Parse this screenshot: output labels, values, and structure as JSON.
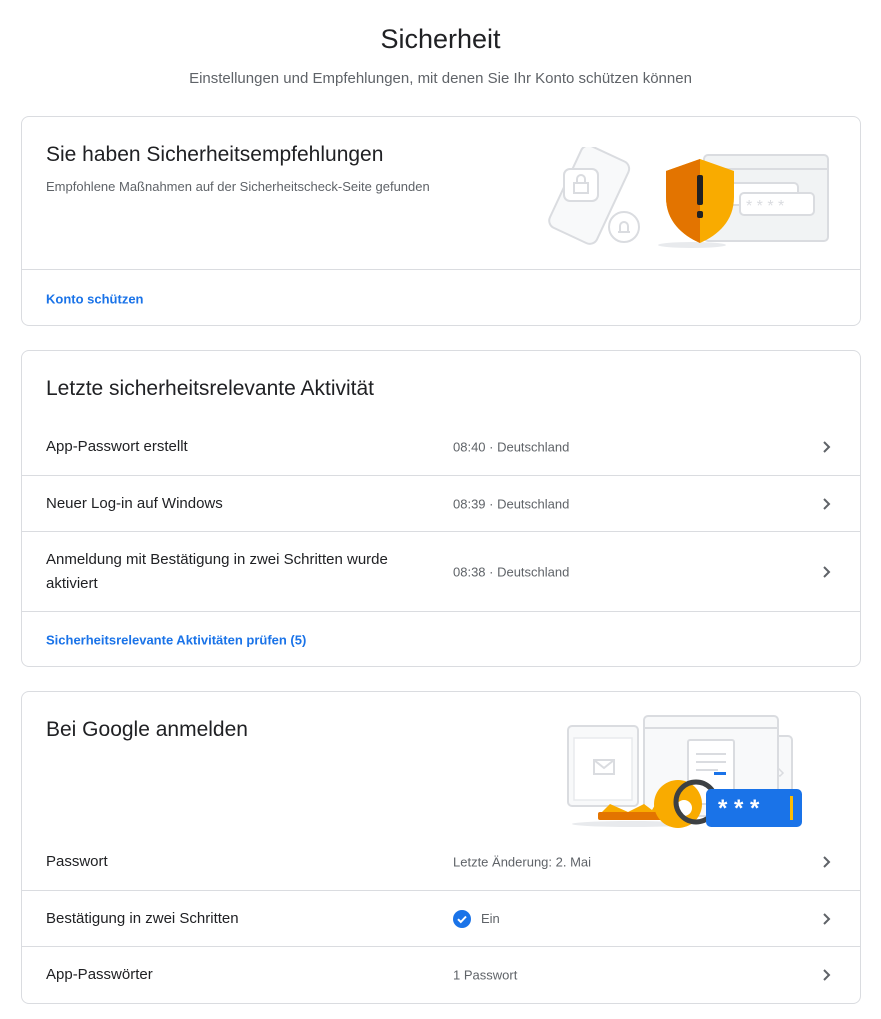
{
  "header": {
    "title": "Sicherheit",
    "subtitle": "Einstellungen und Empfehlungen, mit denen Sie Ihr Konto schützen können"
  },
  "recommendations": {
    "title": "Sie haben Sicherheitsempfehlungen",
    "description": "Empfohlene Maßnahmen auf der Sicherheitscheck-Seite gefunden",
    "link": "Konto schützen",
    "illustration_icon": "warning-shield-icon"
  },
  "activity": {
    "title": "Letzte sicherheitsrelevante Aktivität",
    "rows": [
      {
        "label": "App-Passwort erstellt",
        "value": "08:40 · Deutschland"
      },
      {
        "label": "Neuer Log-in auf Windows",
        "value": "08:39 · Deutschland"
      },
      {
        "label": "Anmeldung mit Bestätigung in zwei Schritten wurde aktiviert",
        "value": "08:38 · Deutschland"
      }
    ],
    "link": "Sicherheitsrelevante Aktivitäten prüfen (5)"
  },
  "signin": {
    "title": "Bei Google anmelden",
    "rows": [
      {
        "label": "Passwort",
        "value": "Letzte Änderung: 2. Mai"
      },
      {
        "label": "Bestätigung in zwei Schritten",
        "value": "Ein",
        "icon": "check-circle-icon"
      },
      {
        "label": "App-Passwörter",
        "value": "1 Passwort"
      }
    ],
    "illustration_icon": "key-password-icon"
  },
  "colors": {
    "link": "#1a73e8",
    "warning": "#f9ab00",
    "check": "#1a73e8",
    "password_field": "#1a73e8"
  }
}
